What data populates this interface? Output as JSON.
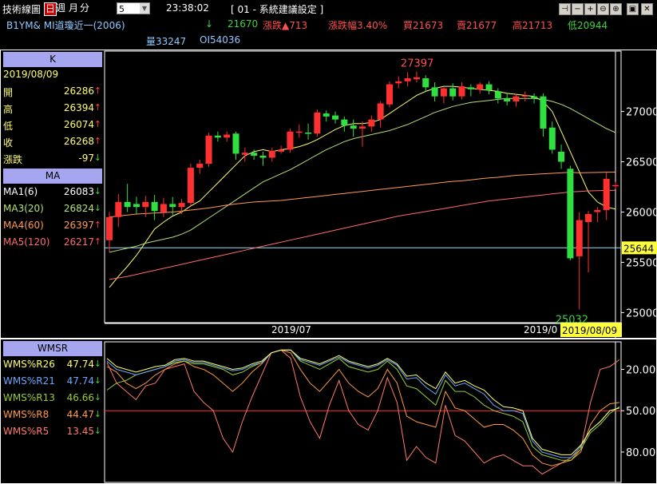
{
  "toolbar": {
    "title": "技術線圖",
    "periods": [
      "日",
      "週",
      "月",
      "分"
    ],
    "interval_value": "5",
    "time": "23:38:02",
    "config_label": "[ 01 - 系統建議設定 ]",
    "window_icons": [
      "pin-icon",
      "minus-icon",
      "plus-icon",
      "zoom-out-icon",
      "zoom-in-icon",
      "image-icon",
      "close-icon"
    ]
  },
  "quote": {
    "symbol": "B1YM&  MI道瓊近一(2006)",
    "last_arrow": "↓",
    "last": "21670",
    "change": "漲跌▲713",
    "change_pct": "漲跌幅3.40%",
    "bid": "買21673",
    "ask": "賣21677",
    "high": "高21713",
    "low": "低20944",
    "volume": "量33247",
    "oi": "OI54036"
  },
  "k_panel": {
    "header": "K",
    "date": "2019/08/09",
    "rows": [
      {
        "label": "開",
        "value": "26286",
        "arrow": "↑"
      },
      {
        "label": "高",
        "value": "26394",
        "arrow": "↑"
      },
      {
        "label": "低",
        "value": "26074",
        "arrow": "↑"
      },
      {
        "label": "收",
        "value": "26268",
        "arrow": "↑"
      },
      {
        "label": "漲跌",
        "value": "-97",
        "arrow": "↓"
      }
    ]
  },
  "ma_panel": {
    "header": "MA",
    "rows": [
      {
        "label": "MA1(6)",
        "value": "26083",
        "arrow": "↓",
        "color": "#ffffff"
      },
      {
        "label": "MA3(20)",
        "value": "26824",
        "arrow": "↓",
        "color": "#b8e07a"
      },
      {
        "label": "MA4(60)",
        "value": "26397",
        "arrow": "↑",
        "color": "#ff9a55"
      },
      {
        "label": "MA5(120)",
        "value": "26217",
        "arrow": "↑",
        "color": "#ff6a6a"
      }
    ]
  },
  "wmsr_panel": {
    "header": "WMSR",
    "rows": [
      {
        "label": "WMS%R26",
        "value": "47.74",
        "arrow": "↓",
        "color": "#ffff70"
      },
      {
        "label": "WMS%R21",
        "value": "47.74",
        "arrow": "↓",
        "color": "#6aa8ff"
      },
      {
        "label": "WMS%R13",
        "value": "46.66",
        "arrow": "↓",
        "color": "#9acd32"
      },
      {
        "label": "WMS%R8",
        "value": "44.47",
        "arrow": "↓",
        "color": "#ff9a40"
      },
      {
        "label": "WMS%R5",
        "value": "13.45",
        "arrow": "↓",
        "color": "#ff7a6a"
      }
    ]
  },
  "chart_data": [
    {
      "type": "candlestick",
      "price_ticks": [
        "27000",
        "26500",
        "26000",
        "25500",
        "25000"
      ],
      "x_labels": [
        "2019/07",
        "2019/0"
      ],
      "current_date": "2019/08/09",
      "current_price": "25644",
      "high_annotation": "27397",
      "low_annotation": "25032",
      "ylim": [
        24900,
        27600
      ],
      "candles": [
        [
          25720,
          26000,
          25600,
          25950
        ],
        [
          25950,
          26180,
          25850,
          26100
        ],
        [
          26100,
          26280,
          26000,
          26050
        ],
        [
          26080,
          26150,
          25980,
          26050
        ],
        [
          26050,
          26160,
          25950,
          26100
        ],
        [
          26100,
          26170,
          25920,
          26010
        ],
        [
          26000,
          26140,
          25950,
          26080
        ],
        [
          26080,
          26150,
          25970,
          26050
        ],
        [
          26050,
          26130,
          25980,
          26090
        ],
        [
          26090,
          26480,
          26060,
          26440
        ],
        [
          26440,
          26520,
          26380,
          26480
        ],
        [
          26480,
          26790,
          26450,
          26760
        ],
        [
          26760,
          26800,
          26700,
          26740
        ],
        [
          26740,
          26800,
          26700,
          26770
        ],
        [
          26780,
          26800,
          26520,
          26580
        ],
        [
          26570,
          26640,
          26500,
          26590
        ],
        [
          26590,
          26620,
          26520,
          26560
        ],
        [
          26560,
          26600,
          26460,
          26540
        ],
        [
          26540,
          26640,
          26500,
          26610
        ],
        [
          26600,
          26660,
          26580,
          26620
        ],
        [
          26620,
          26830,
          26590,
          26800
        ],
        [
          26790,
          26870,
          26740,
          26800
        ],
        [
          26790,
          26880,
          26720,
          26780
        ],
        [
          26780,
          27020,
          26750,
          26990
        ],
        [
          26980,
          27010,
          26900,
          26950
        ],
        [
          26960,
          27000,
          26880,
          26920
        ],
        [
          26920,
          26950,
          26800,
          26860
        ],
        [
          26860,
          26920,
          26750,
          26830
        ],
        [
          26830,
          26900,
          26650,
          26850
        ],
        [
          26850,
          26960,
          26800,
          26920
        ],
        [
          26920,
          27100,
          26840,
          27080
        ],
        [
          27070,
          27300,
          27040,
          27270
        ],
        [
          27280,
          27350,
          27230,
          27300
        ],
        [
          27300,
          27390,
          27250,
          27330
        ],
        [
          27320,
          27397,
          27290,
          27340
        ],
        [
          27330,
          27360,
          27200,
          27240
        ],
        [
          27240,
          27290,
          27100,
          27150
        ],
        [
          27150,
          27240,
          27080,
          27230
        ],
        [
          27230,
          27280,
          27110,
          27150
        ],
        [
          27150,
          27290,
          27120,
          27250
        ],
        [
          27240,
          27270,
          27150,
          27220
        ],
        [
          27220,
          27290,
          27180,
          27270
        ],
        [
          27270,
          27300,
          27170,
          27210
        ],
        [
          27200,
          27230,
          27080,
          27130
        ],
        [
          27130,
          27180,
          27060,
          27100
        ],
        [
          27100,
          27170,
          27050,
          27150
        ],
        [
          27150,
          27200,
          27100,
          27160
        ],
        [
          27150,
          27180,
          27080,
          27130
        ],
        [
          27150,
          27180,
          26750,
          26830
        ],
        [
          26840,
          26900,
          26580,
          26620
        ],
        [
          26600,
          26670,
          26430,
          26500
        ],
        [
          26430,
          26460,
          25520,
          25540
        ],
        [
          25560,
          26000,
          25032,
          25920
        ],
        [
          25900,
          26010,
          25400,
          25980
        ],
        [
          26000,
          26050,
          25900,
          26020
        ],
        [
          26020,
          26394,
          25920,
          26330
        ],
        [
          26260,
          26300,
          26230,
          26268
        ]
      ],
      "moving_averages": [
        {
          "name": "MA1(6)",
          "color": "#ffff70",
          "values": [
            25250,
            25360,
            25460,
            25570,
            25700,
            25830,
            25900,
            25960,
            26000,
            26060,
            26110,
            26200,
            26290,
            26380,
            26470,
            26560,
            26600,
            26620,
            26600,
            26620,
            26630,
            26650,
            26680,
            26720,
            26770,
            26820,
            26860,
            26880,
            26880,
            26890,
            26920,
            26980,
            27040,
            27100,
            27160,
            27200,
            27230,
            27250,
            27250,
            27240,
            27230,
            27220,
            27210,
            27200,
            27180,
            27170,
            27160,
            27150,
            27100,
            27000,
            26800,
            26600,
            26400,
            26200,
            26100,
            26050,
            26030
          ]
        },
        {
          "name": "MA3(20)",
          "color": "#b8e07a",
          "values": [
            25600,
            25620,
            25640,
            25660,
            25690,
            25710,
            25730,
            25750,
            25780,
            25820,
            25880,
            25940,
            26000,
            26060,
            26120,
            26180,
            26240,
            26300,
            26340,
            26380,
            26420,
            26470,
            26520,
            26570,
            26620,
            26660,
            26700,
            26730,
            26750,
            26770,
            26790,
            26810,
            26840,
            26870,
            26910,
            26950,
            26990,
            27020,
            27050,
            27070,
            27090,
            27100,
            27110,
            27120,
            27130,
            27130,
            27130,
            27130,
            27120,
            27100,
            27070,
            27030,
            26980,
            26930,
            26880,
            26830,
            26790
          ]
        },
        {
          "name": "MA4(60)",
          "color": "#ff9a55",
          "values": [
            25950,
            25960,
            25970,
            25980,
            25985,
            25990,
            25995,
            26000,
            26010,
            26020,
            26030,
            26040,
            26055,
            26070,
            26080,
            26090,
            26100,
            26105,
            26110,
            26115,
            26125,
            26135,
            26145,
            26155,
            26165,
            26175,
            26185,
            26195,
            26205,
            26215,
            26225,
            26235,
            26245,
            26255,
            26265,
            26275,
            26285,
            26295,
            26305,
            26310,
            26320,
            26330,
            26340,
            26345,
            26355,
            26365,
            26370,
            26375,
            26380,
            26385,
            26390,
            26395,
            26390,
            26392,
            26394,
            26396,
            26397
          ]
        },
        {
          "name": "MA5(120)",
          "color": "#ff6a6a",
          "values": [
            25330,
            25345,
            25360,
            25380,
            25400,
            25420,
            25440,
            25460,
            25480,
            25500,
            25520,
            25540,
            25560,
            25580,
            25600,
            25620,
            25640,
            25660,
            25680,
            25700,
            25720,
            25740,
            25760,
            25780,
            25800,
            25820,
            25840,
            25860,
            25880,
            25900,
            25920,
            25940,
            25960,
            25975,
            25990,
            26005,
            26020,
            26035,
            26050,
            26065,
            26080,
            26095,
            26110,
            26120,
            26130,
            26140,
            26150,
            26160,
            26170,
            26180,
            26190,
            26200,
            26205,
            26210,
            26213,
            26215,
            26217
          ]
        }
      ]
    },
    {
      "type": "line",
      "y_ticks": [
        "20.00",
        "50.00",
        "80.00"
      ],
      "ylim": [
        100,
        0
      ],
      "reference_line": 50,
      "series": [
        {
          "name": "WMS%R26",
          "color": "#ffff70",
          "values": [
            12,
            18,
            20,
            22,
            20,
            18,
            17,
            13,
            12,
            14,
            14,
            16,
            18,
            20,
            19,
            16,
            14,
            8,
            6,
            6,
            12,
            14,
            16,
            13,
            10,
            14,
            16,
            18,
            16,
            12,
            16,
            25,
            24,
            30,
            34,
            22,
            30,
            28,
            32,
            35,
            42,
            47,
            48,
            50,
            70,
            78,
            80,
            82,
            82,
            75,
            64,
            58,
            50,
            48
          ]
        },
        {
          "name": "WMS%R21",
          "color": "#6aa8ff",
          "values": [
            14,
            20,
            22,
            24,
            22,
            20,
            18,
            14,
            13,
            15,
            15,
            17,
            19,
            21,
            20,
            17,
            15,
            8,
            6,
            6,
            13,
            15,
            17,
            14,
            11,
            15,
            17,
            19,
            17,
            13,
            17,
            27,
            26,
            33,
            38,
            24,
            32,
            30,
            34,
            38,
            46,
            50,
            50,
            52,
            72,
            80,
            82,
            84,
            84,
            76,
            64,
            58,
            50,
            48
          ]
        },
        {
          "name": "WMS%R13",
          "color": "#9acd32",
          "values": [
            35,
            30,
            28,
            24,
            22,
            20,
            18,
            15,
            14,
            16,
            16,
            18,
            20,
            24,
            22,
            18,
            15,
            8,
            6,
            6,
            14,
            17,
            20,
            16,
            12,
            18,
            20,
            22,
            20,
            14,
            20,
            32,
            34,
            40,
            46,
            28,
            36,
            36,
            40,
            46,
            50,
            52,
            54,
            58,
            76,
            82,
            84,
            86,
            86,
            78,
            66,
            60,
            52,
            47
          ]
        },
        {
          "name": "WMS%R8",
          "color": "#ff9a40",
          "values": [
            18,
            22,
            30,
            34,
            30,
            24,
            20,
            16,
            14,
            18,
            20,
            24,
            30,
            36,
            30,
            22,
            16,
            8,
            6,
            8,
            20,
            30,
            36,
            28,
            20,
            30,
            36,
            40,
            34,
            20,
            30,
            54,
            58,
            60,
            62,
            36,
            48,
            50,
            56,
            62,
            60,
            60,
            64,
            70,
            82,
            88,
            90,
            88,
            86,
            80,
            60,
            50,
            45,
            44
          ]
        },
        {
          "name": "WMS%R5",
          "color": "#ff7a6a",
          "values": [
            15,
            30,
            36,
            42,
            32,
            30,
            20,
            18,
            16,
            36,
            44,
            50,
            70,
            80,
            58,
            40,
            24,
            8,
            6,
            12,
            40,
            58,
            70,
            46,
            28,
            50,
            60,
            64,
            50,
            26,
            44,
            86,
            76,
            84,
            88,
            46,
            68,
            72,
            80,
            88,
            84,
            82,
            86,
            90,
            90,
            96,
            92,
            88,
            84,
            78,
            44,
            20,
            18,
            13
          ]
        }
      ]
    }
  ]
}
